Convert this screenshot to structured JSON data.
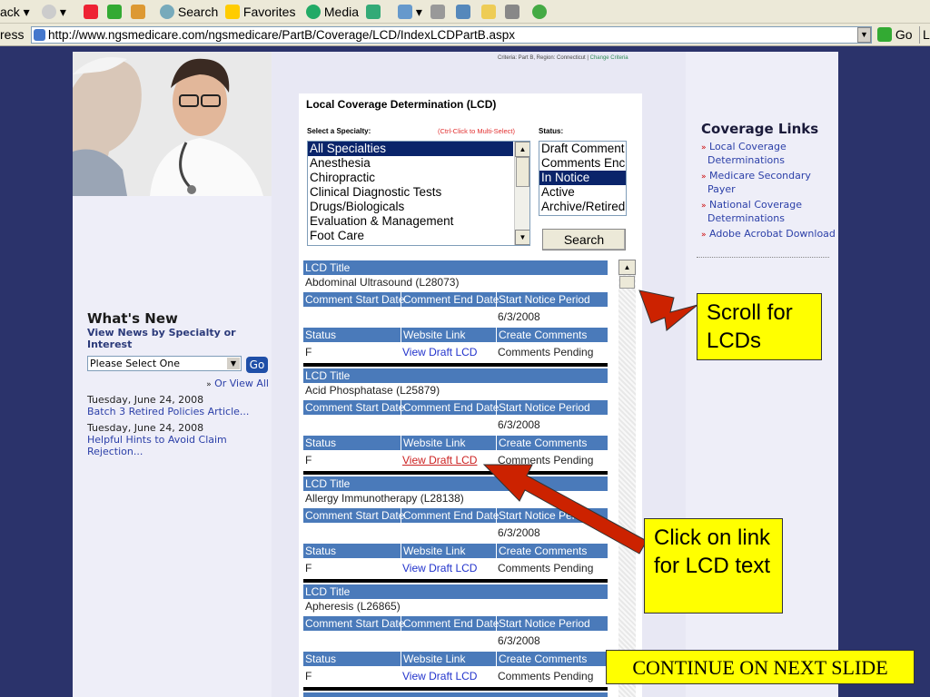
{
  "toolbar": {
    "back_label": "ack",
    "search_label": "Search",
    "favorites_label": "Favorites",
    "media_label": "Media"
  },
  "address": {
    "label": "ress",
    "url": "http://www.ngsmedicare.com/ngsmedicare/PartB/Coverage/LCD/IndexLCDPartB.aspx",
    "go_label": "Go",
    "links_label": "L"
  },
  "criteria": {
    "text": "Criteria: Part B, Region: Connecticut |",
    "change": "Change Criteria"
  },
  "lcd_form": {
    "title": "Local Coverage Determination (LCD)",
    "specialty_label": "Select a Specialty:",
    "ctrl_hint": "(Ctrl-Click to Multi-Select)",
    "status_label": "Status:",
    "specialties": [
      "All Specialties",
      "Anesthesia",
      "Chiropractic",
      "Clinical Diagnostic Tests",
      "Drugs/Biologicals",
      "Evaluation & Management",
      "Foot Care"
    ],
    "selected_specialty": "All Specialties",
    "statuses": [
      "Draft Comment",
      "Comments Enc",
      "In Notice",
      "Active",
      "Archive/Retired"
    ],
    "selected_status": "In Notice",
    "search_label": "Search"
  },
  "table_headers": {
    "lcd_title": "LCD Title",
    "comment_start": "Comment Start Date",
    "comment_end": "Comment End Date",
    "start_notice": "Start Notice Period",
    "status": "Status",
    "website_link": "Website Link",
    "create_comments": "Create Comments"
  },
  "lcds": [
    {
      "title": "Abdominal Ultrasound (L28073)",
      "comment_start": "",
      "comment_end": "",
      "start_notice": "6/3/2008",
      "status": "F",
      "link": "View Draft LCD",
      "create_comments": "Comments Pending"
    },
    {
      "title": "Acid Phosphatase (L25879)",
      "comment_start": "",
      "comment_end": "",
      "start_notice": "6/3/2008",
      "status": "F",
      "link": "View Draft LCD",
      "create_comments": "Comments Pending"
    },
    {
      "title": "Allergy Immunotherapy (L28138)",
      "comment_start": "",
      "comment_end": "",
      "start_notice": "6/3/2008",
      "status": "F",
      "link": "View Draft LCD",
      "create_comments": "Comments Pending"
    },
    {
      "title": "Apheresis (L26865)",
      "comment_start": "",
      "comment_end": "",
      "start_notice": "6/3/2008",
      "status": "F",
      "link": "View Draft LCD",
      "create_comments": "Comments Pending"
    }
  ],
  "whats_new": {
    "title": "What's New",
    "subtitle": "View News by Specialty or Interest",
    "select_value": "Please Select One",
    "go_label": "Go",
    "or_view_all": "Or View All",
    "items": [
      {
        "date": "Tuesday, June 24, 2008",
        "link": "Batch 3 Retired Policies Article..."
      },
      {
        "date": "Tuesday, June 24, 2008",
        "link": "Helpful Hints to Avoid Claim Rejection..."
      }
    ]
  },
  "coverage_links": {
    "title": "Coverage Links",
    "items": [
      "Local Coverage Determinations",
      "Medicare Secondary Payer",
      "National Coverage Determinations",
      "Adobe Acrobat Download"
    ]
  },
  "callouts": {
    "scroll": "Scroll for LCDs",
    "click": "Click on link for LCD text",
    "continue": "CONTINUE ON NEXT SLIDE"
  },
  "colors": {
    "outer_bg": "#2b336b",
    "header_blue": "#4a7aba",
    "selection": "#0a246a",
    "callout_yellow": "#ffff00",
    "arrow_red": "#cc2200"
  }
}
